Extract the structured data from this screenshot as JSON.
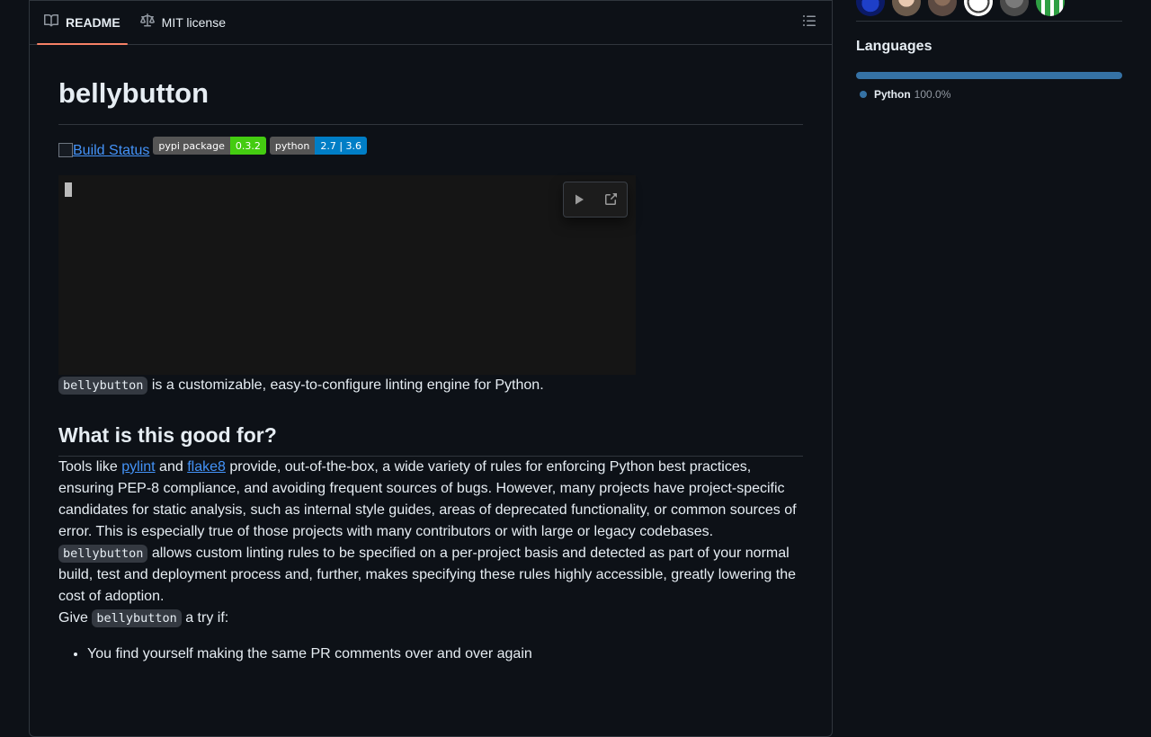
{
  "tabs": [
    {
      "label": "README",
      "icon": "book-icon",
      "active": true
    },
    {
      "label": "MIT license",
      "icon": "scale-icon",
      "active": false
    }
  ],
  "readme": {
    "title": "bellybutton",
    "badges": {
      "build_status_alt": "Build Status",
      "pypi": {
        "label": "pypi package",
        "value": "0.3.2",
        "color": "#44cc11"
      },
      "python": {
        "label": "python",
        "value": "2.7 | 3.6",
        "color": "#007ec6"
      }
    },
    "intro_code": "bellybutton",
    "intro_text": " is a customizable, easy-to-configure linting engine for Python.",
    "section_heading": "What is this good for?",
    "para1": {
      "pre": "Tools like ",
      "link1": "pylint",
      "mid": " and ",
      "link2": "flake8",
      "post": " provide, out-of-the-box, a wide variety of rules for enforcing Python best practices, ensuring PEP-8 compliance, and avoiding frequent sources of bugs. However, many projects have project-specific candidates for static analysis, such as internal style guides, areas of deprecated functionality, or common sources of error. This is especially true of those projects with many contributors or with large or legacy codebases."
    },
    "para2": {
      "code": "bellybutton",
      "text": " allows custom linting rules to be specified on a per-project basis and detected as part of your normal build, test and deployment process and, further, makes specifying these rules highly accessible, greatly lowering the cost of adoption."
    },
    "para3": {
      "pre": "Give ",
      "code": "bellybutton",
      "post": " a try if:"
    },
    "bullets": [
      "You find yourself making the same PR comments over and over again"
    ]
  },
  "sidebar": {
    "languages_heading": "Languages",
    "languages": [
      {
        "name": "Python",
        "percent": "100.0%",
        "share": 100,
        "color": "#3572A5"
      }
    ]
  },
  "colors": {
    "background": "#0d1117",
    "border": "#30363d",
    "link": "#4493f8",
    "tab_accent": "#f78166"
  }
}
